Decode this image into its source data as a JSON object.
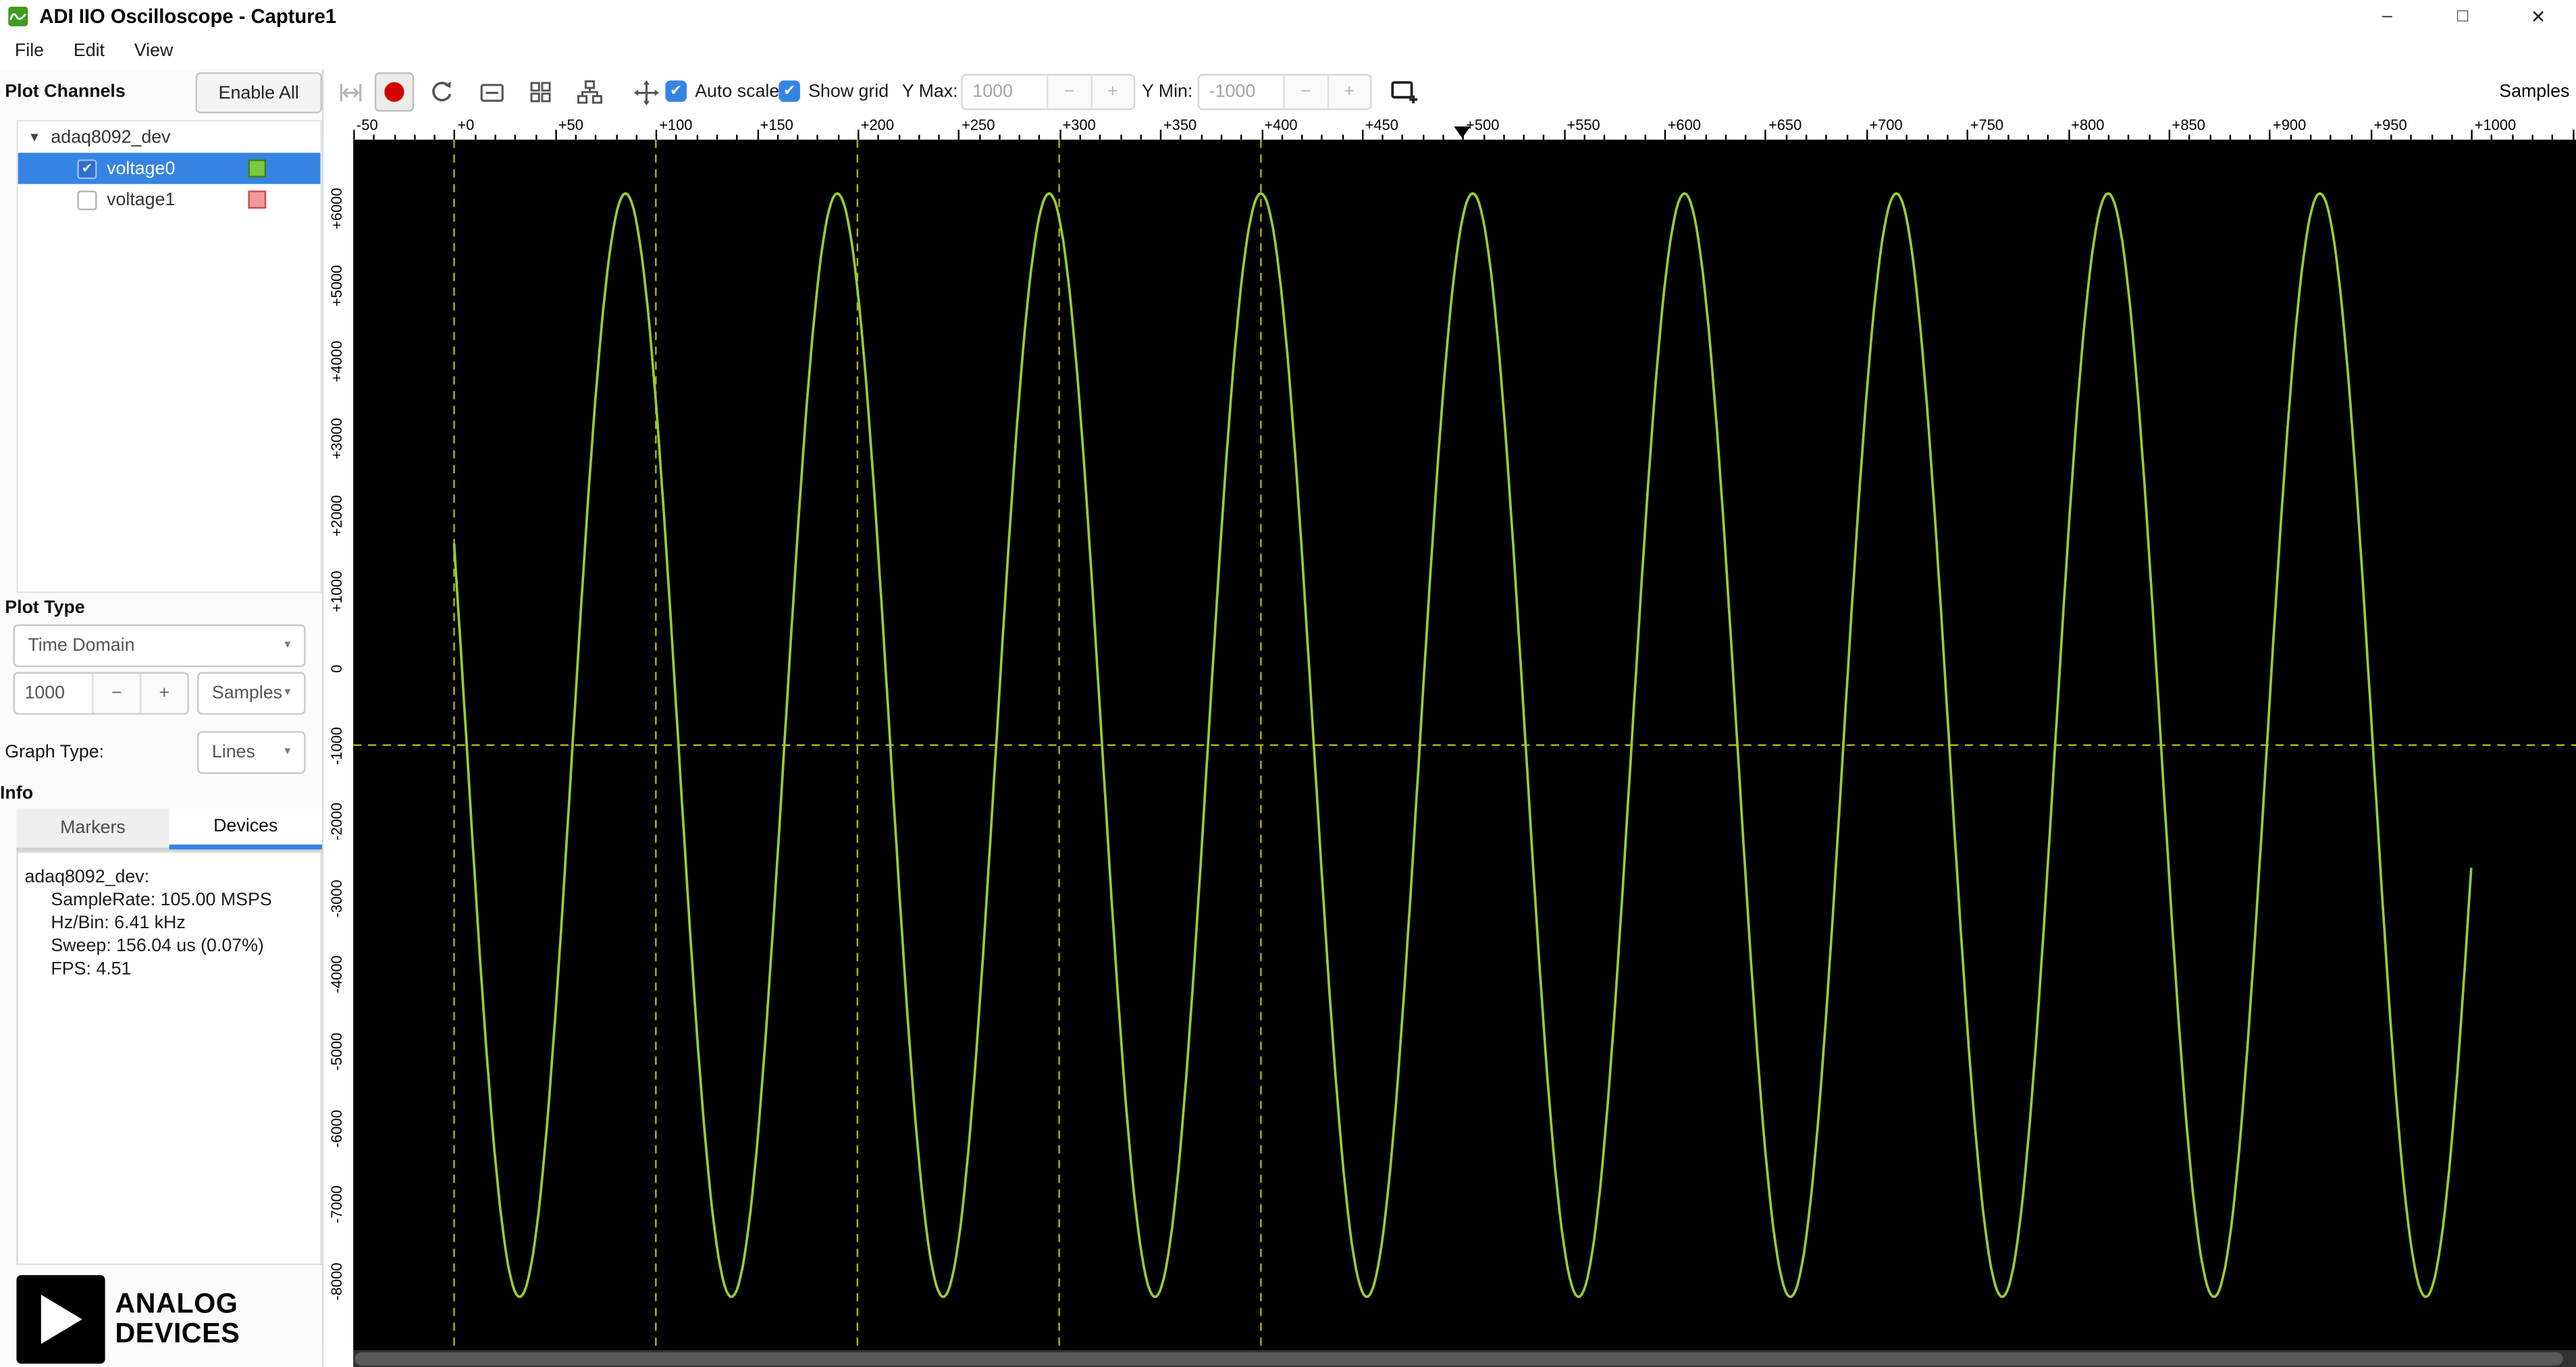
{
  "window": {
    "title": "ADI IIO Oscilloscope - Capture1"
  },
  "icons": {
    "chevron_down": "▼",
    "expander_down": "▼",
    "check": "✔",
    "minus": "−",
    "plus": "+",
    "minimize": "–",
    "maximize": "□",
    "close": "✕"
  },
  "menu": {
    "items": [
      {
        "label": "File"
      },
      {
        "label": "Edit"
      },
      {
        "label": "View"
      }
    ]
  },
  "toolbar": {
    "auto_scale_label": "Auto scale",
    "auto_scale_checked": true,
    "show_grid_label": "Show grid",
    "show_grid_checked": true,
    "y_max_label": "Y Max:",
    "y_max_value": "1000",
    "y_min_label": "Y Min:",
    "y_min_value": "-1000",
    "samples_unit_label": "Samples"
  },
  "sidebar": {
    "plot_channels_label": "Plot Channels",
    "enable_all_label": "Enable All",
    "device_group": "adaq8092_dev",
    "channels": [
      {
        "name": "voltage0",
        "checked": true,
        "selected": true,
        "color": "#78c841"
      },
      {
        "name": "voltage1",
        "checked": false,
        "selected": false,
        "color": "#f29a9a"
      }
    ],
    "plot_type_label": "Plot Type",
    "plot_type_value": "Time Domain",
    "sample_count_value": "1000",
    "sample_unit_value": "Samples",
    "graph_type_label": "Graph Type:",
    "graph_type_value": "Lines",
    "info_label": "Info",
    "tabs": [
      {
        "label": "Markers",
        "active": false
      },
      {
        "label": "Devices",
        "active": true
      }
    ],
    "device_info": {
      "device": "adaq8092_dev:",
      "lines": [
        "SampleRate: 105.00 MSPS",
        "Hz/Bin: 6.41 kHz",
        "Sweep: 156.04 us (0.07%)",
        "FPS: 4.51"
      ]
    },
    "logo": {
      "line1": "ANALOG",
      "line2": "DEVICES"
    }
  },
  "chart_data": {
    "type": "line",
    "title": "",
    "xlabel": "Samples",
    "ylabel": "",
    "x_range": [
      -50,
      1052
    ],
    "x_major_tick": 50,
    "x_minor_tick": 10,
    "x_tick_labels": [
      "-50",
      "+0",
      "+50",
      "+100",
      "+150",
      "+200",
      "+250",
      "+300",
      "+350",
      "+400",
      "+450",
      "+500",
      "+550",
      "+600",
      "+650",
      "+700",
      "+750",
      "+800",
      "+850",
      "+900",
      "+950",
      "+1000"
    ],
    "marker_position": 500,
    "y_view_range": [
      -8900,
      6900
    ],
    "y_tick_values": [
      6000,
      5000,
      4000,
      3000,
      2000,
      1000,
      0,
      -1000,
      -2000,
      -3000,
      -4000,
      -5000,
      -6000,
      -7000,
      -8000
    ],
    "y_tick_labels": [
      "+6000",
      "+5000",
      "+4000",
      "+3000",
      "+2000",
      "+1000",
      "0",
      "-1000",
      "-2000",
      "-3000",
      "-4000",
      "-5000",
      "-6000",
      "-7000",
      "-8000"
    ],
    "grid_on": true,
    "grid_vertical_x": [
      0,
      100,
      200,
      300,
      400
    ],
    "grid_horizontal_value": -1000,
    "series": [
      {
        "name": "voltage0",
        "waveform": "sine",
        "color": "#9acd32",
        "samples": 1000,
        "amplitude": 7200,
        "offset": -1000,
        "period_samples": 105,
        "peak_sample": 85
      }
    ],
    "colors": {
      "background": "#000000",
      "grid": "#b3b300"
    }
  }
}
